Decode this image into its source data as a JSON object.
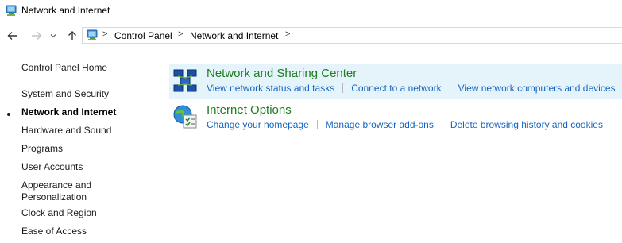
{
  "window": {
    "title": "Network and Internet",
    "icon": "control-panel-icon"
  },
  "nav": {
    "back_icon": "back-arrow-icon",
    "forward_icon": "forward-arrow-icon",
    "recent_icon": "chevron-down-icon",
    "up_icon": "up-arrow-icon",
    "address": {
      "icon": "control-panel-icon",
      "breadcrumbs": [
        "Control Panel",
        "Network and Internet"
      ],
      "separator": ">"
    }
  },
  "sidebar": {
    "home": "Control Panel Home",
    "items": [
      {
        "label": "System and Security"
      },
      {
        "label": "Network and Internet",
        "active": true
      },
      {
        "label": "Hardware and Sound"
      },
      {
        "label": "Programs"
      },
      {
        "label": "User Accounts"
      },
      {
        "label": "Appearance and\nPersonalization"
      },
      {
        "label": "Clock and Region"
      },
      {
        "label": "Ease of Access"
      }
    ]
  },
  "categories": [
    {
      "title": "Network and Sharing Center",
      "icon": "network-sharing-icon",
      "links": [
        "View network status and tasks",
        "Connect to a network",
        "View network computers and devices"
      ]
    },
    {
      "title": "Internet Options",
      "icon": "internet-options-icon",
      "links": [
        "Change your homepage",
        "Manage browser add-ons",
        "Delete browsing history and cookies"
      ]
    }
  ],
  "colors": {
    "category_title": "#1e7d1e",
    "link": "#1565c0",
    "highlight": "#e5f3fb"
  }
}
